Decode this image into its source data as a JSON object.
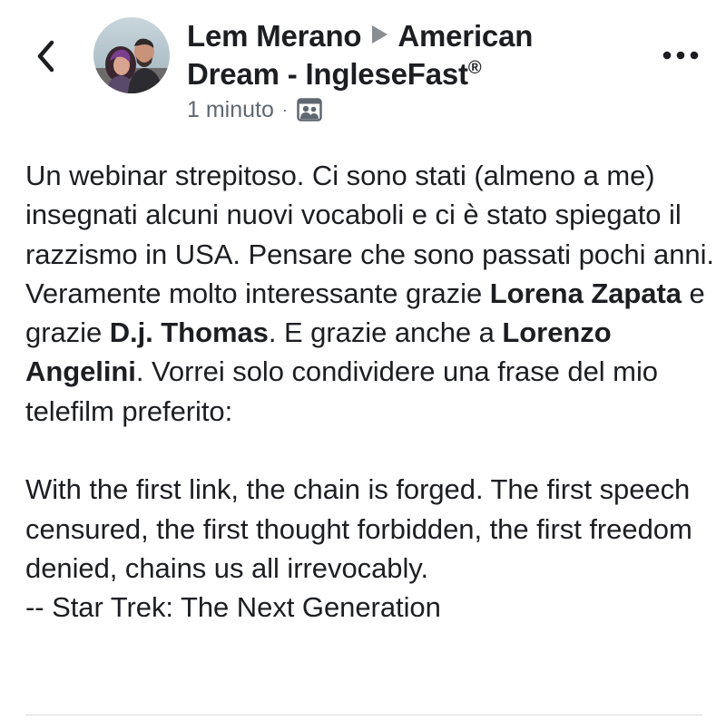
{
  "header": {
    "author": "Lem Merano",
    "group": "American Dream - IngleseFast",
    "group_mark": "®",
    "timestamp": "1 minuto",
    "separator": "·",
    "back_icon": "chevron-left-icon",
    "more_icon": "more-horizontal-icon",
    "privacy_icon": "group-icon"
  },
  "post": {
    "p1_t1": "Un webinar strepitoso. Ci sono stati (almeno a me) insegnati alcuni nuovi vocaboli e ci è stato spiegato il razzismo in USA. Pensare che sono passati pochi anni. Veramente molto interessante grazie ",
    "mention1": "Lorena Zapata",
    "p1_t2": " e grazie ",
    "mention2": "D.j. Thomas",
    "p1_t3": ". E grazie anche a ",
    "mention3": "Lorenzo Angelini",
    "p1_t4": ". Vorrei solo condividere una frase del mio telefilm preferito:",
    "quote": "With the first link, the chain is forged. The first speech censured, the first thought forbidden, the first freedom denied, chains us all irrevocably.",
    "attribution": "-- Star Trek: The Next Generation"
  },
  "colors": {
    "text": "#1c1e21",
    "meta": "#606770",
    "divider": "#dadde1"
  }
}
